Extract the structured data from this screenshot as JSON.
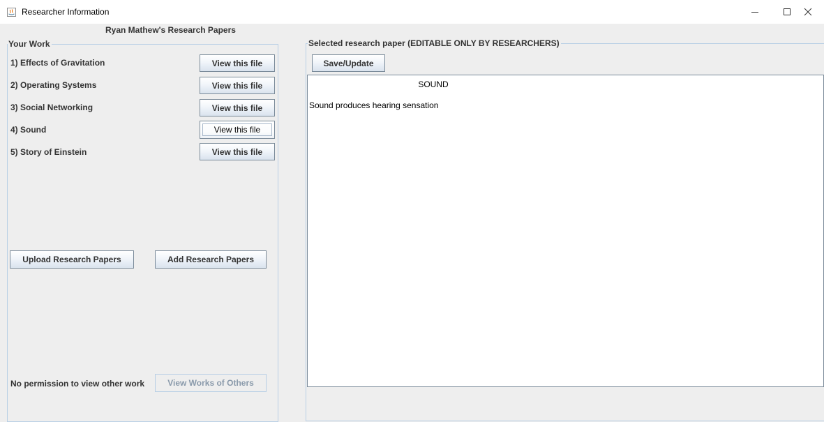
{
  "window": {
    "title": "Researcher Information",
    "controls": [
      "minimize-icon",
      "maximize-icon",
      "close-icon"
    ]
  },
  "left": {
    "header": "Ryan Mathew's Research Papers",
    "group_title": "Your Work",
    "papers": [
      {
        "label": "1) Effects of Gravitation",
        "button": "View this file"
      },
      {
        "label": "2) Operating Systems",
        "button": "View this file"
      },
      {
        "label": "3) Social Networking",
        "button": "View this file"
      },
      {
        "label": "4) Sound",
        "button": "View this file"
      },
      {
        "label": "5) Story of Einstein",
        "button": "View this file"
      }
    ],
    "upload_button": "Upload Research Papers",
    "add_button": "Add Research Papers",
    "permission_text": "No permission to view other work",
    "others_button": "View Works of Others"
  },
  "right": {
    "group_title": "Selected research paper (EDITABLE ONLY BY RESEARCHERS)",
    "save_button": "Save/Update",
    "document": {
      "heading": "SOUND",
      "body": "Sound produces hearing sensation"
    }
  },
  "colors": {
    "background": "#eeeeee",
    "border": "#b8cfe5",
    "text": "#333333"
  }
}
